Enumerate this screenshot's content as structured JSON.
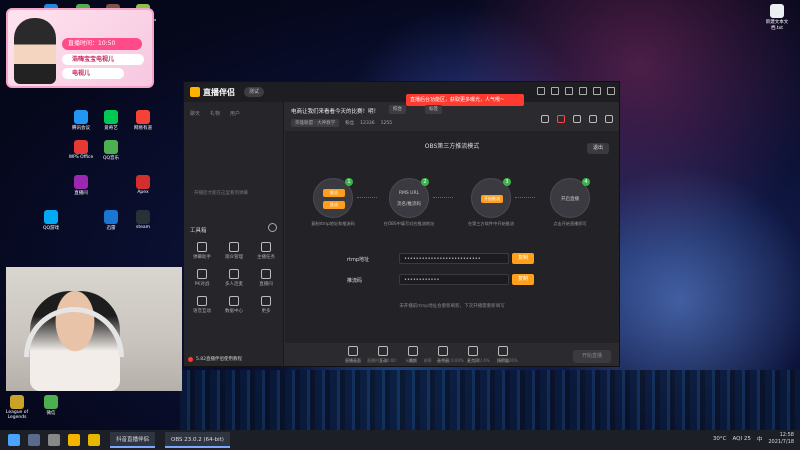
{
  "desktop": {
    "icons": [
      {
        "label": "Microsoft Edge"
      },
      {
        "label": "Tricky Towers"
      },
      {
        "label": "新征途之"
      },
      {
        "label": "植物大战僵尸"
      },
      {
        "label": "腾讯会议"
      },
      {
        "label": "爱奇艺"
      },
      {
        "label": "WPS Office"
      },
      {
        "label": "网易有道"
      },
      {
        "label": "QQ音乐"
      },
      {
        "label": "直播间"
      },
      {
        "label": "QQ游戏"
      },
      {
        "label": "Apex"
      },
      {
        "label": "迅雷"
      },
      {
        "label": "steam"
      },
      {
        "label": "新建文本文档.txt"
      },
      {
        "label": "League of Legends"
      },
      {
        "label": "微信"
      }
    ]
  },
  "overlay": {
    "live_time": "直播时间：10:50",
    "line1": "浩嗨宝宝电视儿",
    "line2": "电视儿"
  },
  "app": {
    "logo": "直播伴侣",
    "beta": "测试",
    "promo": "直播后台功能区，获取更多曝光，人气哦~",
    "left_tabs": [
      "聊天",
      "礼物",
      "用户"
    ],
    "chat_hint": "开播后才能在这里看到弹幕",
    "tools_title": "工具箱",
    "tools": [
      {
        "label": "弹幕助手"
      },
      {
        "label": "观众管理"
      },
      {
        "label": "主播任务"
      },
      {
        "label": "PK对战"
      },
      {
        "label": "多人连麦"
      },
      {
        "label": "直播间"
      },
      {
        "label": "语音互动"
      },
      {
        "label": "数据中心"
      },
      {
        "label": "更多"
      }
    ],
    "status": "5.82直播伴侣使用教程",
    "room_title": "电商让我们来看看今天的比赛！明！",
    "tags": [
      "综合",
      "标签"
    ],
    "meta": {
      "category": "英雄联盟 · 大神教学",
      "fans_label": "粉丝",
      "fans": "12336",
      "likes": "1255"
    },
    "mode_title": "OBS第三方推流模式",
    "exit": "退出",
    "steps": [
      {
        "num": "1",
        "pill_a": "推流",
        "pill_b": "推流",
        "caption": "复制rtmp地址和推流码"
      },
      {
        "num": "2",
        "line1": "RMS URL",
        "line2": "流名/推流码",
        "caption": "在OBS中填写对应推流地址"
      },
      {
        "num": "3",
        "pill": "开始推流",
        "caption": "在第三方软件中开始推流"
      },
      {
        "num": "4",
        "label": "开启直播",
        "caption": "点击开始直播即可"
      }
    ],
    "rtmp_label": "rtmp地址",
    "rtmp_value": "••••••••••••••••••••••••••",
    "key_label": "推流码",
    "key_value": "••••••••••••",
    "copy_label": "复制",
    "tip": "未开播前rtmp地址会重新刷新，下次开播需重新填写",
    "bottom_tools": [
      {
        "label": "直播画面"
      },
      {
        "label": "互动"
      },
      {
        "label": "美颜"
      },
      {
        "label": "画中画"
      },
      {
        "label": "麦克风"
      },
      {
        "label": "扬声器"
      }
    ],
    "start_label": "开始直播",
    "stats": [
      "直播时长 00:00",
      "码率",
      "帧率",
      "丢帧 0.00%",
      "CPU 4%",
      "内存 26%"
    ]
  },
  "taskbar": {
    "tasks": [
      "抖音直播伴侣",
      "OBS 23.0.2 (64-bit)"
    ],
    "weather": "30°C",
    "aqi": "AQI 25",
    "ime": "中",
    "time": "12:58",
    "date": "2021/7/18"
  }
}
